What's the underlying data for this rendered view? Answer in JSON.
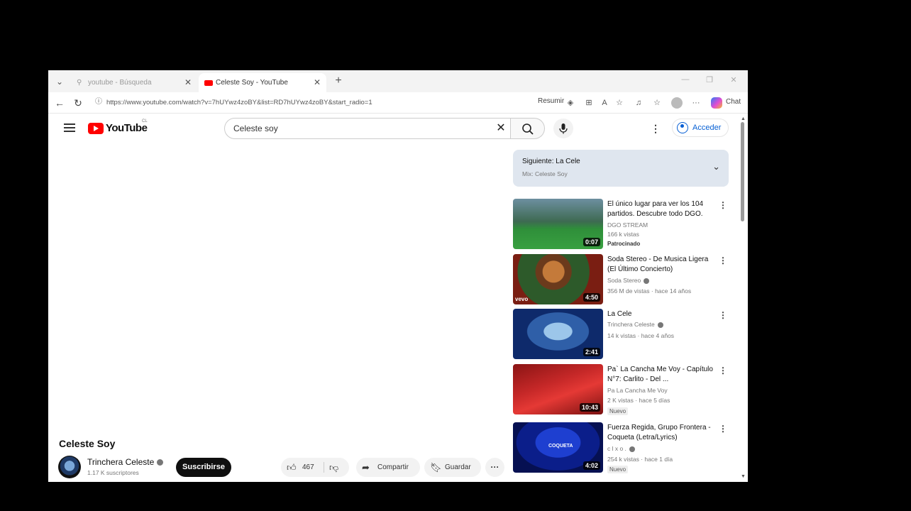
{
  "browser": {
    "tabs": [
      {
        "title": "youtube - Búsqueda",
        "active": false
      },
      {
        "title": "Celeste Soy - YouTube",
        "active": true
      }
    ],
    "url": "https://www.youtube.com/watch?v=7hUYwz4zoBY&list=RD7hUYwz4zoBY&start_radio=1",
    "resumir_label": "Resumir",
    "chat_label": "Chat"
  },
  "masthead": {
    "logo_text": "YouTube",
    "country_code": "CL",
    "search_query": "Celeste soy",
    "signin_label": "Acceder"
  },
  "video": {
    "title": "Celeste Soy",
    "channel": "Trinchera Celeste",
    "subscribers": "1.17 K suscriptores",
    "subscribe_label": "Suscribirse",
    "likes": "467",
    "share_label": "Compartir",
    "save_label": "Guardar"
  },
  "up_next": {
    "title": "Siguiente: La Cele",
    "subtitle": "Mix: Celeste Soy"
  },
  "recommendations": [
    {
      "title": "El único lugar para ver los 104 partidos. Descubre todo DGO.",
      "channel": "DGO STREAM",
      "meta": "166 k vistas",
      "badge": "Patrocinado",
      "duration": "0:07"
    },
    {
      "title": "Soda Stereo - De Musica Ligera (El Último Concierto)",
      "channel": "Soda Stereo",
      "meta": "356 M de vistas · hace 14 años",
      "badge": "",
      "duration": "4:50",
      "thumb_mark": "vevo"
    },
    {
      "title": "La Cele",
      "channel": "Trinchera Celeste",
      "meta": "14 k vistas · hace 4 años",
      "badge": "",
      "duration": "2:41"
    },
    {
      "title": "Pa` La Cancha Me Voy - Capítulo N°7: Carlito - Del ...",
      "channel": "Pa La Cancha Me Voy",
      "meta": "2 K vistas · hace 5 días",
      "badge": "Nuevo",
      "duration": "10:43"
    },
    {
      "title": "Fuerza Regida, Grupo Frontera - Coqueta (Letra/Lyrics)",
      "channel": "c l x o .",
      "meta": "254 k vistas · hace 1 día",
      "badge": "Nuevo",
      "duration": "4:02",
      "thumb_mark": "COQUETA"
    }
  ]
}
